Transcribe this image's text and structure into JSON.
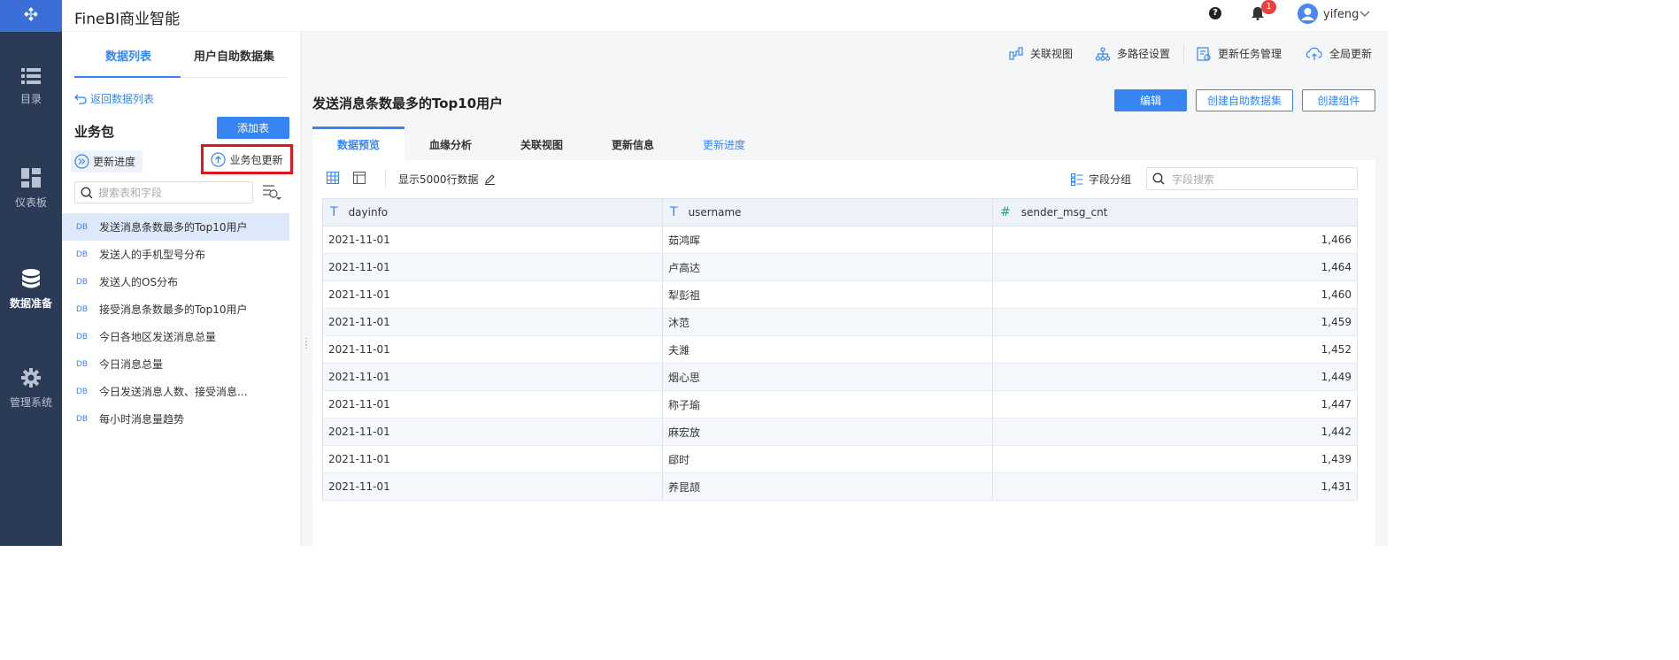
{
  "app": {
    "title": "FineBI商业智能"
  },
  "leftnav": [
    {
      "label": "目录",
      "icon": "list-icon"
    },
    {
      "label": "仪表板",
      "icon": "dashboard-icon"
    },
    {
      "label": "数据准备",
      "icon": "database-icon",
      "active": true
    },
    {
      "label": "管理系统",
      "icon": "gear-icon"
    }
  ],
  "header": {
    "help": "?",
    "notifications": "1",
    "user": "yifeng"
  },
  "side": {
    "tabs": [
      "数据列表",
      "用户自助数据集"
    ],
    "back": "返回数据列表",
    "package_title": "业务包",
    "add_table": "添加表",
    "update_progress": "更新进度",
    "package_update": "业务包更新",
    "search_placeholder": "搜索表和字段",
    "tables": [
      "发送消息条数最多的Top10用户",
      "发送人的手机型号分布",
      "发送人的OS分布",
      "接受消息条数最多的Top10用户",
      "今日各地区发送消息总量",
      "今日消息总量",
      "今日发送消息人数、接受消息...",
      "每小时消息量趋势"
    ],
    "db_tag": "DB"
  },
  "top_actions": [
    "关联视图",
    "多路径设置",
    "更新任务管理",
    "全局更新"
  ],
  "main": {
    "title": "发送消息条数最多的Top10用户",
    "buttons": {
      "edit": "编辑",
      "create_dataset": "创建自助数据集",
      "create_component": "创建组件"
    },
    "tabs": [
      "数据预览",
      "血缘分析",
      "关联视图",
      "更新信息",
      "更新进度"
    ],
    "row_limit": "显示5000行数据",
    "field_group": "字段分组",
    "field_search_placeholder": "字段搜索"
  },
  "table": {
    "columns": [
      {
        "type": "T",
        "name": "dayinfo"
      },
      {
        "type": "T",
        "name": "username"
      },
      {
        "type": "#",
        "name": "sender_msg_cnt"
      }
    ],
    "rows": [
      [
        "2021-11-01",
        "茹鸿晖",
        "1,466"
      ],
      [
        "2021-11-01",
        "卢高达",
        "1,464"
      ],
      [
        "2021-11-01",
        "犁彭祖",
        "1,460"
      ],
      [
        "2021-11-01",
        "沐范",
        "1,459"
      ],
      [
        "2021-11-01",
        "夫濰",
        "1,452"
      ],
      [
        "2021-11-01",
        "烟心思",
        "1,449"
      ],
      [
        "2021-11-01",
        "称子瑜",
        "1,447"
      ],
      [
        "2021-11-01",
        "麻宏放",
        "1,442"
      ],
      [
        "2021-11-01",
        "郈时",
        "1,439"
      ],
      [
        "2021-11-01",
        "养昆颉",
        "1,431"
      ]
    ]
  },
  "colors": {
    "accent": "#3685f2",
    "nav_bg": "#2b3a55",
    "highlight_border": "#e1161c"
  }
}
